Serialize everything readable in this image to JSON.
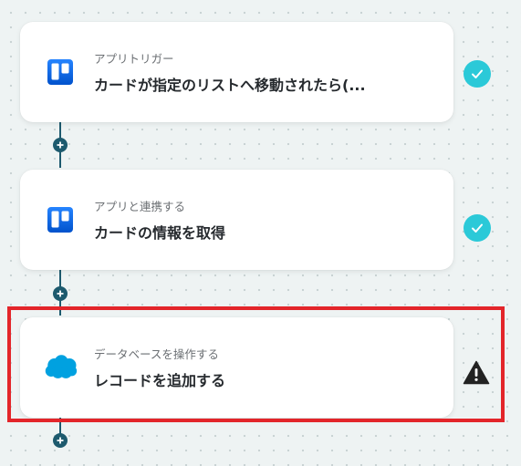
{
  "flow": {
    "steps": [
      {
        "subtitle": "アプリトリガー",
        "title": "カードが指定のリストへ移動されたら(...",
        "app_icon": "trello-icon",
        "status": "complete"
      },
      {
        "subtitle": "アプリと連携する",
        "title": "カードの情報を取得",
        "app_icon": "trello-icon",
        "status": "complete"
      },
      {
        "subtitle": "データベースを操作する",
        "title": "レコードを追加する",
        "app_icon": "salesforce-icon",
        "status": "warning"
      }
    ],
    "add_step_icon": "plus-icon"
  },
  "colors": {
    "connector": "#1d5a6e",
    "status_complete": "#2bc9d8",
    "status_warning": "#222222",
    "highlight_border": "#e3252a",
    "trello_blue": "#1668dc",
    "salesforce_blue": "#00a1e0"
  }
}
